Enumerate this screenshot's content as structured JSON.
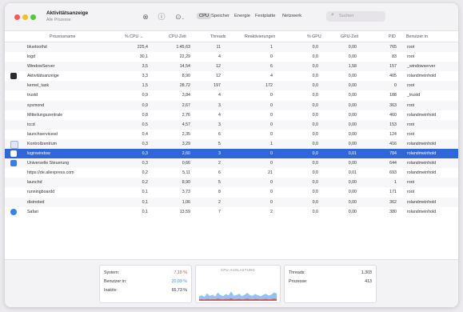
{
  "window": {
    "title": "Aktivitätsanzeige",
    "subtitle": "Alle Prozesse"
  },
  "toolbar": {
    "icons": [
      "close-circle-icon",
      "info-icon",
      "more-icon"
    ],
    "tabs": [
      "CPU",
      "Speicher",
      "Energie",
      "Festplatte",
      "Netzwerk"
    ],
    "active_tab": "CPU",
    "search_placeholder": "Suchen"
  },
  "columns": [
    "Prozessname",
    "% CPU",
    "CPU-Zeit",
    "Threads",
    "Reaktivierungen",
    "% GPU",
    "GPU-Zeit",
    "PID",
    "Benutzer:in"
  ],
  "processes": [
    {
      "name": "bluetoothd",
      "cpu": "225,4",
      "cpu_time": "1:45,63",
      "threads": "11",
      "wakeups": "1",
      "gpu": "0,0",
      "gpu_time": "0,00",
      "pid": "765",
      "user": "root",
      "icon": ""
    },
    {
      "name": "logd",
      "cpu": "30,1",
      "cpu_time": "22,29",
      "threads": "4",
      "wakeups": "0",
      "gpu": "0,0",
      "gpu_time": "0,00",
      "pid": "83",
      "user": "root",
      "icon": ""
    },
    {
      "name": "WindowServer",
      "cpu": "3,5",
      "cpu_time": "14,54",
      "threads": "12",
      "wakeups": "6",
      "gpu": "0,0",
      "gpu_time": "1,58",
      "pid": "157",
      "user": "_windowserver",
      "icon": ""
    },
    {
      "name": "Aktivitätsanzeige",
      "cpu": "3,3",
      "cpu_time": "8,90",
      "threads": "12",
      "wakeups": "4",
      "gpu": "0,0",
      "gpu_time": "0,00",
      "pid": "405",
      "user": "rolandmeinhold",
      "icon": "dark"
    },
    {
      "name": "kernel_task",
      "cpu": "1,5",
      "cpu_time": "28,72",
      "threads": "197",
      "wakeups": "172",
      "gpu": "0,0",
      "gpu_time": "0,00",
      "pid": "0",
      "user": "root",
      "icon": ""
    },
    {
      "name": "trustd",
      "cpu": "0,9",
      "cpu_time": "3,84",
      "threads": "4",
      "wakeups": "0",
      "gpu": "0,0",
      "gpu_time": "0,00",
      "pid": "188",
      "user": "_trustd",
      "icon": ""
    },
    {
      "name": "sysmond",
      "cpu": "0,9",
      "cpu_time": "2,67",
      "threads": "3",
      "wakeups": "0",
      "gpu": "0,0",
      "gpu_time": "0,00",
      "pid": "363",
      "user": "root",
      "icon": ""
    },
    {
      "name": "Mitteilungszentrale",
      "cpu": "0,8",
      "cpu_time": "2,76",
      "threads": "4",
      "wakeups": "0",
      "gpu": "0,0",
      "gpu_time": "0,00",
      "pid": "460",
      "user": "rolandmeinhold",
      "icon": ""
    },
    {
      "name": "tccd",
      "cpu": "0,5",
      "cpu_time": "4,57",
      "threads": "3",
      "wakeups": "0",
      "gpu": "0,0",
      "gpu_time": "0,00",
      "pid": "153",
      "user": "root",
      "icon": ""
    },
    {
      "name": "launchservicesd",
      "cpu": "0,4",
      "cpu_time": "2,35",
      "threads": "6",
      "wakeups": "0",
      "gpu": "0,0",
      "gpu_time": "0,00",
      "pid": "124",
      "user": "root",
      "icon": ""
    },
    {
      "name": "Kontrollzentrum",
      "cpu": "0,3",
      "cpu_time": "3,29",
      "threads": "5",
      "wakeups": "1",
      "gpu": "0,0",
      "gpu_time": "0,00",
      "pid": "416",
      "user": "rolandmeinhold",
      "icon": "checkbox"
    },
    {
      "name": "loginwindow",
      "cpu": "0,3",
      "cpu_time": "2,60",
      "threads": "3",
      "wakeups": "0",
      "gpu": "0,0",
      "gpu_time": "0,01",
      "pid": "784",
      "user": "rolandmeinhold",
      "icon": "blue-doc",
      "selected": true
    },
    {
      "name": "Universelle Steuerung",
      "cpu": "0,3",
      "cpu_time": "0,66",
      "threads": "2",
      "wakeups": "0",
      "gpu": "0,0",
      "gpu_time": "0,00",
      "pid": "644",
      "user": "rolandmeinhold",
      "icon": "blue"
    },
    {
      "name": "https://de.aliexpress.com",
      "cpu": "0,2",
      "cpu_time": "5,11",
      "threads": "6",
      "wakeups": "21",
      "gpu": "0,0",
      "gpu_time": "0,01",
      "pid": "693",
      "user": "rolandmeinhold",
      "icon": ""
    },
    {
      "name": "launchd",
      "cpu": "0,2",
      "cpu_time": "8,90",
      "threads": "5",
      "wakeups": "0",
      "gpu": "0,0",
      "gpu_time": "0,00",
      "pid": "1",
      "user": "root",
      "icon": ""
    },
    {
      "name": "runningboardd",
      "cpu": "0,1",
      "cpu_time": "3,73",
      "threads": "8",
      "wakeups": "0",
      "gpu": "0,0",
      "gpu_time": "0,00",
      "pid": "171",
      "user": "root",
      "icon": ""
    },
    {
      "name": "distnoted",
      "cpu": "0,1",
      "cpu_time": "1,06",
      "threads": "2",
      "wakeups": "0",
      "gpu": "0,0",
      "gpu_time": "0,00",
      "pid": "362",
      "user": "rolandmeinhold",
      "icon": ""
    },
    {
      "name": "Safari",
      "cpu": "0,1",
      "cpu_time": "13,59",
      "threads": "7",
      "wakeups": "2",
      "gpu": "0,0",
      "gpu_time": "0,00",
      "pid": "380",
      "user": "rolandmeinhold",
      "icon": "safari"
    }
  ],
  "summary": {
    "system_label": "System:",
    "system_value": "7,18 %",
    "user_label": "Benutzer:in:",
    "user_value": "20,09 %",
    "idle_label": "Inaktiv:",
    "idle_value": "65,73 %",
    "chart_title": "CPU-AUSLASTUNG",
    "threads_label": "Threads:",
    "threads_value": "1.303",
    "processes_label": "Prozesse:",
    "processes_value": "413"
  },
  "colors": {
    "system": "#e0483f",
    "user": "#3b8ee8",
    "selection": "#2f66d9"
  },
  "cpu_load_history": {
    "system": [
      0.05,
      0.06,
      0.04,
      0.07,
      0.05,
      0.06,
      0.05,
      0.08,
      0.06,
      0.05,
      0.07,
      0.06,
      0.09,
      0.05,
      0.06,
      0.07,
      0.05,
      0.06,
      0.08,
      0.06,
      0.05,
      0.07,
      0.06,
      0.05,
      0.06,
      0.07,
      0.05,
      0.06,
      0.08,
      0.07
    ],
    "user": [
      0.12,
      0.14,
      0.1,
      0.2,
      0.13,
      0.16,
      0.11,
      0.22,
      0.15,
      0.12,
      0.18,
      0.14,
      0.25,
      0.13,
      0.15,
      0.19,
      0.12,
      0.16,
      0.21,
      0.15,
      0.13,
      0.18,
      0.14,
      0.12,
      0.16,
      0.19,
      0.14,
      0.17,
      0.22,
      0.2
    ]
  }
}
